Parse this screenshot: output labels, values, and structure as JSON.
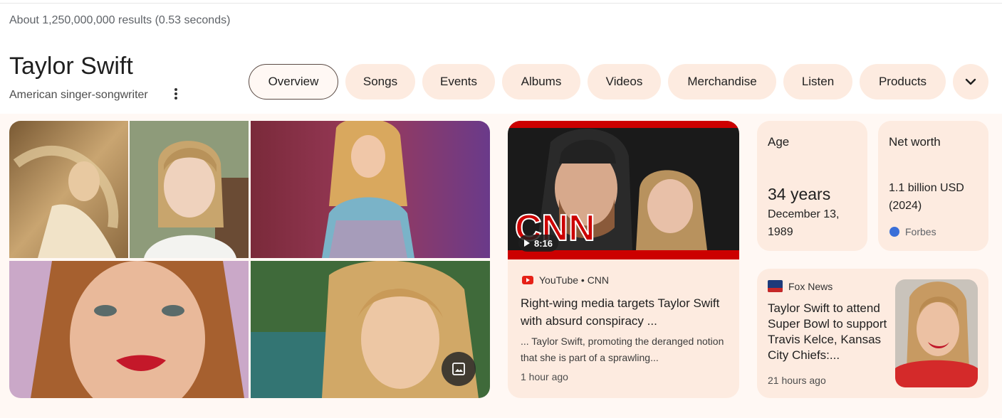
{
  "results_stats": "About 1,250,000,000 results (0.53 seconds)",
  "entity": {
    "title": "Taylor Swift",
    "subtitle": "American singer-songwriter"
  },
  "chips": [
    {
      "label": "Overview",
      "selected": true
    },
    {
      "label": "Songs",
      "selected": false
    },
    {
      "label": "Events",
      "selected": false
    },
    {
      "label": "Albums",
      "selected": false
    },
    {
      "label": "Videos",
      "selected": false
    },
    {
      "label": "Merchandise",
      "selected": false
    },
    {
      "label": "Listen",
      "selected": false
    },
    {
      "label": "Products",
      "selected": false
    }
  ],
  "video_card": {
    "duration": "8:16",
    "source": "YouTube • CNN",
    "headline": "Right-wing media targets Taylor Swift with absurd conspiracy ...",
    "snippet": "... Taylor Swift, promoting the deranged notion that she is part of a sprawling...",
    "time": "1 hour ago",
    "thumb_logo": "CNN"
  },
  "facts": {
    "age": {
      "label": "Age",
      "value": "34 years",
      "detail": "December 13, 1989"
    },
    "net_worth": {
      "label": "Net worth",
      "value": "1.1 billion USD (2024)",
      "source": "Forbes"
    }
  },
  "news_card": {
    "source": "Fox News",
    "headline": "Taylor Swift to attend Super Bowl to support Travis Kelce, Kansas City Chiefs:...",
    "time": "21 hours ago"
  },
  "colors": {
    "chip_bg": "#fdebe0",
    "panel_bg": "#fff8f4",
    "youtube_red": "#e62117",
    "cnn_red": "#cc0000"
  },
  "icons": [
    "more-vert-icon",
    "chevron-down-icon",
    "photo-icon",
    "play-icon",
    "youtube-icon",
    "globe-icon",
    "fox-news-logo"
  ]
}
